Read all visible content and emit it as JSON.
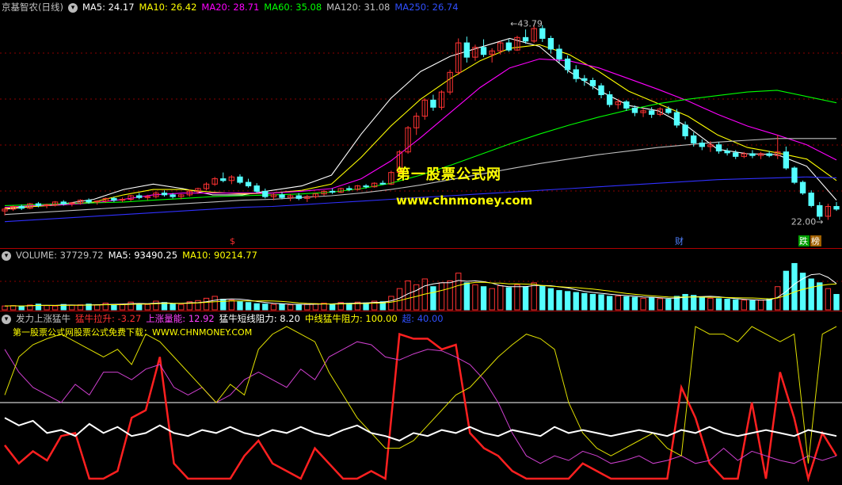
{
  "main_header": {
    "title": "京基智农(日线)",
    "ma5": "MA5: 24.17",
    "ma10": "MA10: 26.42",
    "ma20": "MA20: 28.71",
    "ma60": "MA60: 35.08",
    "ma120": "MA120: 31.08",
    "ma250": "MA250: 26.74"
  },
  "vol_header": {
    "volume": "VOLUME: 37729.72",
    "ma5": "MA5: 93490.25",
    "ma10": "MA10: 90214.77"
  },
  "ind_header": {
    "name": "发力上涨猛牛",
    "a": "猛牛拉升: -3.27",
    "b": "上涨量能: 12.92",
    "c": "猛牛短线阻力: 8.20",
    "d": "中线猛牛阻力: 100.00",
    "e": "超: 40.00"
  },
  "ind_note": "第一股票公式网股票公式免费下载：WWW.CHNMONEY.COM",
  "watermark": {
    "title": "第一股票公式网",
    "url": "www.chnmoney.com"
  },
  "annotations": {
    "high": "43.79",
    "low": "22.00",
    "marker_left": "$",
    "marker_cai": "财",
    "marker_die": "跌",
    "marker_bang": "榜"
  },
  "colors": {
    "up": "#ff3232",
    "down": "#54ffff",
    "ma5": "#ffffff",
    "ma10": "#ffff00",
    "ma20": "#ff00ff",
    "ma60": "#00ff00",
    "ma120": "#c0c0c0",
    "ma250": "#3030ff",
    "grid": "#8b0000"
  },
  "chart_data": [
    {
      "type": "candlestick",
      "title": "京基智农(日线)",
      "ylim": [
        20,
        45
      ],
      "ohlc": [
        [
          23.0,
          23.4,
          22.5,
          23.2
        ],
        [
          23.2,
          23.6,
          23.0,
          23.5
        ],
        [
          23.5,
          23.7,
          23.1,
          23.3
        ],
        [
          23.3,
          23.9,
          23.2,
          23.8
        ],
        [
          23.8,
          24.0,
          23.4,
          23.6
        ],
        [
          23.6,
          23.8,
          23.3,
          23.7
        ],
        [
          23.7,
          24.1,
          23.5,
          24.0
        ],
        [
          24.0,
          24.2,
          23.6,
          23.8
        ],
        [
          23.8,
          24.0,
          23.5,
          23.9
        ],
        [
          23.9,
          24.3,
          23.7,
          24.2
        ],
        [
          24.2,
          24.4,
          23.8,
          24.0
        ],
        [
          24.0,
          24.2,
          23.7,
          24.1
        ],
        [
          24.1,
          24.5,
          23.9,
          24.4
        ],
        [
          24.4,
          24.6,
          24.0,
          24.2
        ],
        [
          24.2,
          24.5,
          24.0,
          24.3
        ],
        [
          24.3,
          24.8,
          24.1,
          24.7
        ],
        [
          24.7,
          25.0,
          24.3,
          24.5
        ],
        [
          24.5,
          24.8,
          24.2,
          24.6
        ],
        [
          24.6,
          25.2,
          24.4,
          25.0
        ],
        [
          25.0,
          25.3,
          24.6,
          24.8
        ],
        [
          24.8,
          25.0,
          24.4,
          24.6
        ],
        [
          24.6,
          24.9,
          24.3,
          24.8
        ],
        [
          24.8,
          25.4,
          24.6,
          25.2
        ],
        [
          25.2,
          25.6,
          24.9,
          25.5
        ],
        [
          25.5,
          26.2,
          25.3,
          26.0
        ],
        [
          26.0,
          26.8,
          25.8,
          26.6
        ],
        [
          26.6,
          27.3,
          26.2,
          26.4
        ],
        [
          26.4,
          27.0,
          26.0,
          26.8
        ],
        [
          26.8,
          27.1,
          26.0,
          26.2
        ],
        [
          26.2,
          26.6,
          25.6,
          25.8
        ],
        [
          25.8,
          26.1,
          25.0,
          25.2
        ],
        [
          25.2,
          25.5,
          24.4,
          24.6
        ],
        [
          24.6,
          25.0,
          24.2,
          24.8
        ],
        [
          24.8,
          25.1,
          24.3,
          24.5
        ],
        [
          24.5,
          24.9,
          24.1,
          24.7
        ],
        [
          24.7,
          25.0,
          24.2,
          24.4
        ],
        [
          24.4,
          24.8,
          24.0,
          24.6
        ],
        [
          24.6,
          25.0,
          24.4,
          24.9
        ],
        [
          24.9,
          25.3,
          24.7,
          25.2
        ],
        [
          25.2,
          25.5,
          24.9,
          25.1
        ],
        [
          25.1,
          25.6,
          25.0,
          25.5
        ],
        [
          25.5,
          25.8,
          25.2,
          25.4
        ],
        [
          25.4,
          25.9,
          25.3,
          25.8
        ],
        [
          25.8,
          26.0,
          25.5,
          25.7
        ],
        [
          25.7,
          26.2,
          25.6,
          26.1
        ],
        [
          26.1,
          26.4,
          25.9,
          26.0
        ],
        [
          26.0,
          27.5,
          25.9,
          27.3
        ],
        [
          27.3,
          29.8,
          27.1,
          29.6
        ],
        [
          29.6,
          32.5,
          29.4,
          32.3
        ],
        [
          32.3,
          34.0,
          31.5,
          33.6
        ],
        [
          33.6,
          35.6,
          33.2,
          35.4
        ],
        [
          35.4,
          36.0,
          34.2,
          34.6
        ],
        [
          34.6,
          36.5,
          34.3,
          36.3
        ],
        [
          36.3,
          38.8,
          36.0,
          38.5
        ],
        [
          38.5,
          42.3,
          38.2,
          41.8
        ],
        [
          41.8,
          42.5,
          39.6,
          40.2
        ],
        [
          40.2,
          41.6,
          39.8,
          41.3
        ],
        [
          41.3,
          42.2,
          40.2,
          40.5
        ],
        [
          40.5,
          41.2,
          39.6,
          40.9
        ],
        [
          40.9,
          42.0,
          40.5,
          41.8
        ],
        [
          41.8,
          42.2,
          40.8,
          41.0
        ],
        [
          41.0,
          42.6,
          40.9,
          42.4
        ],
        [
          42.4,
          43.3,
          41.7,
          42.0
        ],
        [
          42.0,
          43.8,
          41.8,
          43.4
        ],
        [
          43.4,
          43.79,
          41.9,
          42.3
        ],
        [
          42.3,
          42.6,
          40.6,
          41.1
        ],
        [
          41.1,
          41.6,
          39.6,
          40.0
        ],
        [
          40.0,
          40.4,
          38.4,
          38.8
        ],
        [
          38.8,
          39.3,
          37.4,
          37.8
        ],
        [
          37.8,
          38.2,
          37.0,
          37.6
        ],
        [
          37.6,
          37.9,
          36.6,
          37.0
        ],
        [
          37.0,
          37.3,
          35.6,
          36.0
        ],
        [
          36.0,
          36.4,
          34.6,
          34.9
        ],
        [
          34.9,
          35.5,
          34.4,
          35.2
        ],
        [
          35.2,
          35.4,
          34.2,
          34.5
        ],
        [
          34.5,
          34.8,
          33.6,
          34.0
        ],
        [
          34.0,
          34.5,
          33.5,
          34.2
        ],
        [
          34.2,
          34.6,
          33.4,
          33.8
        ],
        [
          33.8,
          34.6,
          33.6,
          34.4
        ],
        [
          34.4,
          34.7,
          33.8,
          34.0
        ],
        [
          34.0,
          34.4,
          32.3,
          32.6
        ],
        [
          32.6,
          33.0,
          31.0,
          31.4
        ],
        [
          31.4,
          31.8,
          30.2,
          30.6
        ],
        [
          30.6,
          31.0,
          29.8,
          30.2
        ],
        [
          30.2,
          30.8,
          29.6,
          30.4
        ],
        [
          30.4,
          30.7,
          29.4,
          29.7
        ],
        [
          29.7,
          30.0,
          29.2,
          29.5
        ],
        [
          29.5,
          29.8,
          28.8,
          29.1
        ],
        [
          29.1,
          29.6,
          28.9,
          29.4
        ],
        [
          29.4,
          29.8,
          28.9,
          29.2
        ],
        [
          29.2,
          29.6,
          28.8,
          29.4
        ],
        [
          29.4,
          29.7,
          29.0,
          29.2
        ],
        [
          29.2,
          31.5,
          28.8,
          29.6
        ],
        [
          29.6,
          30.2,
          27.6,
          27.8
        ],
        [
          27.8,
          28.0,
          26.0,
          26.2
        ],
        [
          26.2,
          26.4,
          24.8,
          25.0
        ],
        [
          25.0,
          25.3,
          23.4,
          23.6
        ],
        [
          23.6,
          24.0,
          22.0,
          22.4
        ],
        [
          22.4,
          23.8,
          22.0,
          23.5
        ],
        [
          23.5,
          24.0,
          23.0,
          23.2
        ]
      ],
      "ma": {
        "MA5": [
          23.2,
          23.5,
          23.8,
          24.3,
          25.4,
          26.0,
          25.5,
          24.8,
          24.8,
          25.3,
          25.8,
          27.0,
          31.6,
          35.6,
          38.6,
          40.3,
          41.3,
          42.3,
          41.4,
          38.6,
          36.5,
          34.8,
          34.2,
          32.4,
          29.9,
          29.4,
          29.3,
          28.0,
          24.2
        ],
        "MA10": [
          23.3,
          23.5,
          23.7,
          24.0,
          24.8,
          25.4,
          25.4,
          25.1,
          24.9,
          25.0,
          25.3,
          26.0,
          29.0,
          32.5,
          35.5,
          37.8,
          39.8,
          41.2,
          41.6,
          40.5,
          38.6,
          36.4,
          35.0,
          33.6,
          31.5,
          30.1,
          29.5,
          28.8,
          26.4
        ],
        "MA20": [
          23.4,
          23.6,
          23.7,
          23.9,
          24.3,
          24.8,
          25.0,
          25.0,
          25.0,
          25.0,
          25.2,
          25.5,
          26.6,
          28.6,
          31.2,
          34.0,
          36.8,
          39.0,
          40.0,
          39.8,
          39.0,
          37.8,
          36.6,
          35.3,
          33.8,
          32.5,
          31.5,
          30.4,
          28.7
        ],
        "MA60": [
          23.6,
          23.7,
          23.8,
          23.9,
          24.0,
          24.2,
          24.4,
          24.6,
          24.7,
          24.8,
          24.9,
          25.1,
          25.5,
          26.1,
          27.0,
          28.1,
          29.3,
          30.5,
          31.6,
          32.6,
          33.5,
          34.3,
          35.0,
          35.5,
          35.9,
          36.3,
          36.5,
          35.8,
          35.1
        ],
        "MA120": [
          22.6,
          22.8,
          23.0,
          23.2,
          23.4,
          23.6,
          23.8,
          24.0,
          24.2,
          24.3,
          24.5,
          24.7,
          25.0,
          25.4,
          25.9,
          26.5,
          27.1,
          27.7,
          28.3,
          28.8,
          29.3,
          29.7,
          30.1,
          30.4,
          30.7,
          30.9,
          31.1,
          31.1,
          31.1
        ],
        "MA250": [
          21.8,
          22.0,
          22.2,
          22.4,
          22.6,
          22.8,
          23.0,
          23.2,
          23.4,
          23.5,
          23.7,
          23.9,
          24.1,
          24.3,
          24.5,
          24.7,
          24.9,
          25.1,
          25.3,
          25.5,
          25.7,
          25.9,
          26.1,
          26.3,
          26.5,
          26.6,
          26.7,
          26.8,
          26.7
        ]
      }
    },
    {
      "type": "bar",
      "title": "VOLUME",
      "values": [
        20,
        22,
        18,
        25,
        30,
        22,
        20,
        28,
        24,
        26,
        30,
        25,
        35,
        28,
        30,
        40,
        32,
        28,
        45,
        38,
        30,
        28,
        42,
        48,
        60,
        70,
        55,
        50,
        42,
        38,
        32,
        30,
        28,
        30,
        26,
        28,
        30,
        32,
        35,
        30,
        38,
        34,
        40,
        36,
        45,
        42,
        70,
        110,
        150,
        130,
        160,
        120,
        140,
        150,
        190,
        140,
        130,
        120,
        110,
        125,
        115,
        130,
        120,
        140,
        125,
        110,
        100,
        95,
        90,
        85,
        80,
        78,
        70,
        72,
        68,
        65,
        60,
        62,
        58,
        55,
        70,
        80,
        75,
        65,
        60,
        58,
        55,
        52,
        50,
        48,
        50,
        55,
        120,
        200,
        240,
        190,
        160,
        140,
        110,
        80
      ],
      "ylim": [
        0,
        250
      ]
    },
    {
      "type": "line",
      "title": "发力上涨猛牛",
      "ylim": [
        0,
        100
      ],
      "series": [
        {
          "name": "猛牛拉升",
          "values": [
            22,
            10,
            18,
            12,
            28,
            30,
            0,
            0,
            5,
            40,
            45,
            80,
            10,
            0,
            0,
            0,
            0,
            15,
            25,
            10,
            5,
            0,
            20,
            10,
            0,
            0,
            5,
            0,
            95,
            92,
            92,
            85,
            88,
            30,
            20,
            15,
            5,
            0,
            0,
            0,
            0,
            10,
            5,
            0,
            0,
            0,
            0,
            0,
            60,
            40,
            10,
            0,
            0,
            50,
            0,
            70,
            40,
            0,
            30,
            15
          ]
        },
        {
          "name": "上涨量能",
          "values": [
            85,
            70,
            60,
            55,
            50,
            62,
            55,
            70,
            70,
            65,
            72,
            75,
            60,
            55,
            60,
            50,
            55,
            65,
            70,
            65,
            60,
            72,
            65,
            80,
            85,
            90,
            88,
            80,
            78,
            82,
            85,
            84,
            80,
            75,
            65,
            50,
            30,
            15,
            10,
            15,
            12,
            18,
            15,
            10,
            12,
            15,
            10,
            12,
            15,
            10,
            12,
            20,
            12,
            18,
            15,
            12,
            10,
            15,
            12,
            15
          ]
        },
        {
          "name": "猛牛短线阻力",
          "values": [
            55,
            80,
            88,
            92,
            95,
            90,
            85,
            80,
            85,
            75,
            95,
            90,
            80,
            70,
            60,
            50,
            62,
            55,
            85,
            95,
            100,
            95,
            90,
            70,
            55,
            40,
            30,
            20,
            20,
            25,
            35,
            45,
            55,
            60,
            70,
            80,
            88,
            95,
            92,
            85,
            50,
            30,
            20,
            15,
            20,
            25,
            30,
            20,
            15,
            100,
            95,
            95,
            90,
            100,
            95,
            90,
            95,
            10,
            95,
            100
          ]
        },
        {
          "name": "中线猛牛阻力",
          "values": [
            40,
            35,
            38,
            30,
            32,
            28,
            36,
            30,
            34,
            28,
            30,
            35,
            30,
            28,
            32,
            30,
            34,
            30,
            28,
            32,
            30,
            34,
            30,
            28,
            32,
            35,
            30,
            28,
            25,
            30,
            28,
            32,
            30,
            34,
            30,
            28,
            32,
            30,
            28,
            34,
            30,
            32,
            30,
            28,
            30,
            32,
            30,
            28,
            32,
            30,
            34,
            30,
            28,
            30,
            32,
            30,
            28,
            32,
            30,
            28
          ]
        }
      ],
      "hline": 50
    }
  ]
}
